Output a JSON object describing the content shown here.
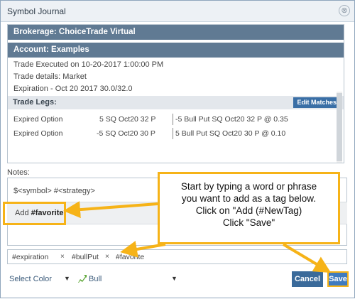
{
  "window": {
    "title": "Symbol Journal",
    "close_glyph": "⊗"
  },
  "details": {
    "brokerage": "Brokerage: ChoiceTrade Virtual",
    "account": "Account: Examples",
    "trade_executed": "Trade Executed on 10-20-2017 1:00:00 PM",
    "trade_details": "Trade details: Market",
    "expiration": "Expiration - Oct 20 2017 30.0/32.0",
    "legs_title": "Trade Legs:",
    "edit_matches_label": "Edit Matches",
    "legs": [
      {
        "type": "Expired Option",
        "qty": "5 SQ Oct20 32 P",
        "desc": "-5 Bull Put SQ Oct20 32 P @ 0.35"
      },
      {
        "type": "Expired Option",
        "qty": "-5 SQ Oct20 30 P",
        "desc": "5 Bull Put SQ Oct20 30 P @ 0.10"
      }
    ]
  },
  "notes": {
    "label": "Notes:",
    "text": "$<symbol> #<strategy>",
    "suggestion_prefix": "Add ",
    "suggestion_tag": "#favorite",
    "suggestion_suffix": "."
  },
  "tags": {
    "items": [
      "#expiration",
      "#bullPut",
      "#favorite"
    ],
    "remove_glyph": "×"
  },
  "footer": {
    "select_color_label": "Select Color",
    "color_value": "Bull",
    "cancel_label": "Cancel",
    "save_label": "Save"
  },
  "callout": {
    "line1": "Start by typing a word or phrase",
    "line2": "you want to add as a tag below.",
    "line3": "Click on \"Add (#NewTag)",
    "line4": "Click \"Save\""
  },
  "colors": {
    "header_bar": "#607a93",
    "highlight": "#f6b318",
    "primary_button": "#3f7bbf",
    "bull_icon": "#5fa83a"
  },
  "icons": {
    "bull": "bull-icon",
    "close": "close-icon",
    "caret": "caret-down-icon"
  }
}
